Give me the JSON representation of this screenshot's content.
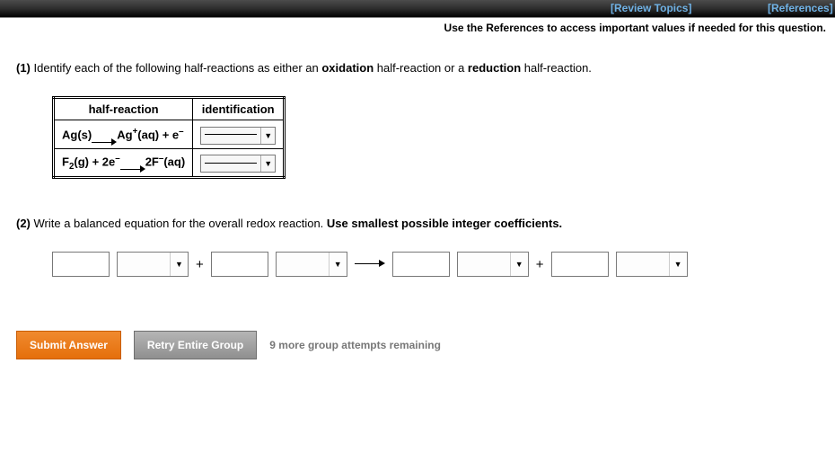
{
  "toolbar": {
    "review_topics": "[Review Topics]",
    "references": "[References]"
  },
  "hint": "Use the References to access important values if needed for this question.",
  "q1": {
    "num": "(1)",
    "text_before_bold1": " Identify each of the following half-reactions as either an ",
    "bold1": "oxidation",
    "mid": " half-reaction or a ",
    "bold2": "reduction",
    "text_after": " half-reaction."
  },
  "table": {
    "header_left": "half-reaction",
    "header_right": "identification",
    "row1": {
      "react_left": "Ag(s)",
      "react_right_pre": "Ag",
      "react_right_sup": "+",
      "react_right_post": "(aq) + e",
      "react_right_supe": "–"
    },
    "row2": {
      "react_left_pre": "F",
      "react_left_sub": "2",
      "react_left_mid": "(g) + 2e",
      "react_left_sup": "–",
      "react_right_pre": "2F",
      "react_right_sup": "–",
      "react_right_post": "(aq)"
    }
  },
  "q2": {
    "num": "(2)",
    "text": " Write a balanced equation for the overall redox reaction. ",
    "bold": "Use smallest possible integer coefficients."
  },
  "plus": "+",
  "buttons": {
    "submit": "Submit Answer",
    "retry": "Retry Entire Group"
  },
  "attempts": "9 more group attempts remaining"
}
